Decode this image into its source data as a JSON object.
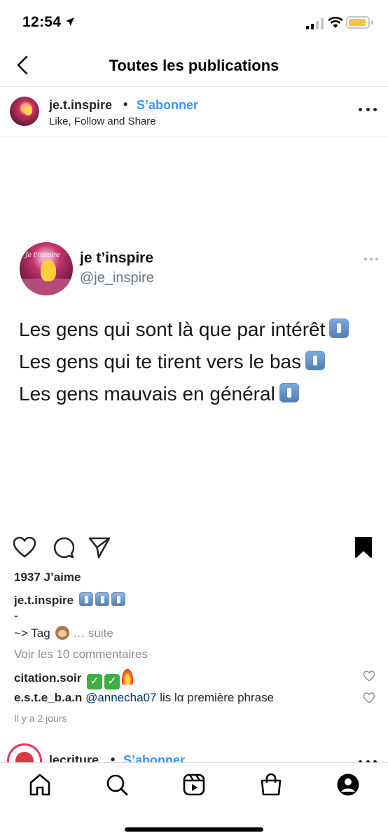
{
  "status_bar": {
    "time": "12:54",
    "battery_level": 0.75,
    "battery_color": "#f5c542"
  },
  "header": {
    "title": "Toutes les publications",
    "back_icon": "chevron-left-icon"
  },
  "post": {
    "username": "je.t.inspire",
    "separator": "•",
    "follow_label": "S’abonner",
    "subtitle": "Like, Follow and Share",
    "more_icon": "more-horizontal-icon",
    "image": {
      "tweet_name": "je t’inspire",
      "tweet_handle": "@je_inspire",
      "avatar_text": "Je t'inspire",
      "lines": [
        "Les gens qui sont là que par intérêt",
        "Les gens qui te tirent vers le bas",
        "Les gens mauvais en général"
      ],
      "line_emoji": "put-litter-in-its-place-emoji"
    },
    "actions": {
      "like_icon": "heart-icon",
      "comment_icon": "comment-icon",
      "share_icon": "paper-plane-icon",
      "save_icon": "bookmark-filled-icon"
    },
    "likes": "1937 J’aime",
    "caption_user": "je.t.inspire",
    "caption_line2": "-",
    "caption_line3": "~> Tag",
    "caption_more": "… suite",
    "view_comments": "Voir les 10 commentaires",
    "comments": [
      {
        "user": "citation.soir",
        "text": ""
      },
      {
        "user": "e.s.t.e_b.a.n",
        "mention": "@annecha07",
        "text": " lis lα première phrase"
      }
    ],
    "timestamp": "Il y a 2 jours"
  },
  "next_post": {
    "username": "lecriture",
    "separator": "•",
    "follow_label": "S’abonner"
  },
  "tab_bar": {
    "items": [
      "home-icon",
      "search-icon",
      "reels-icon",
      "shop-icon",
      "profile-icon"
    ]
  },
  "colors": {
    "link_blue": "#3897f0",
    "text": "#262626",
    "muted": "#8e8e8e",
    "mention": "#00376b"
  }
}
